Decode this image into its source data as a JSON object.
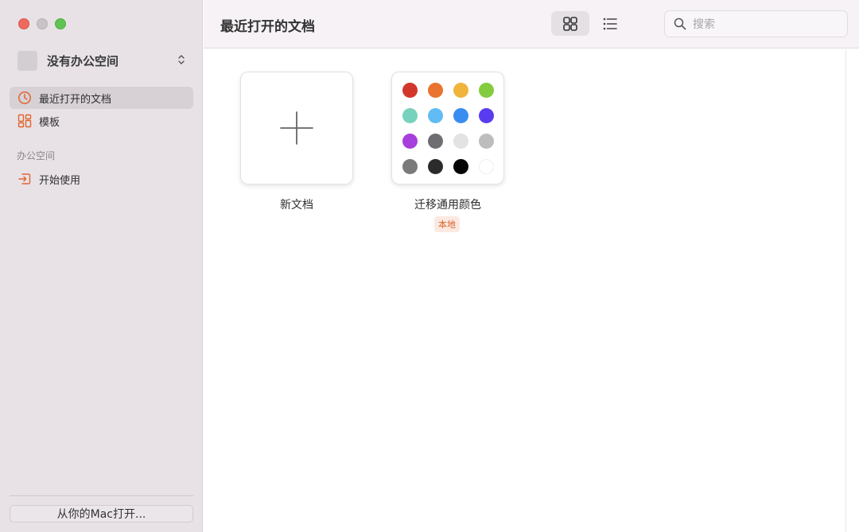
{
  "sidebar": {
    "workspace_name": "没有办公空间",
    "items": [
      {
        "label": "最近打开的文档",
        "icon": "clock-icon"
      },
      {
        "label": "模板",
        "icon": "template-icon"
      }
    ],
    "section_title": "办公空间",
    "section_items": [
      {
        "label": "开始使用",
        "icon": "enter-icon"
      }
    ],
    "open_from_mac": "从你的Mac打开..."
  },
  "header": {
    "title": "最近打开的文档",
    "search_placeholder": "搜索",
    "view_modes": [
      "grid-view-icon",
      "list-view-icon"
    ]
  },
  "documents": [
    {
      "name": "新文档",
      "icon": "plus-icon"
    },
    {
      "name": "迁移通用颜色",
      "badge": "本地",
      "swatches": [
        "#d2372c",
        "#e8742f",
        "#f0b43c",
        "#84cc3f",
        "#76d2bc",
        "#62bcf4",
        "#3a8cf0",
        "#5a3cf0",
        "#a63fdc",
        "#6e6e72",
        "#e3e3e3",
        "#bdbdbd",
        "#7a7a7a",
        "#2b2b2b",
        "#050505",
        "#ffffff"
      ]
    }
  ],
  "colors": {
    "accent": "#e0652e"
  }
}
